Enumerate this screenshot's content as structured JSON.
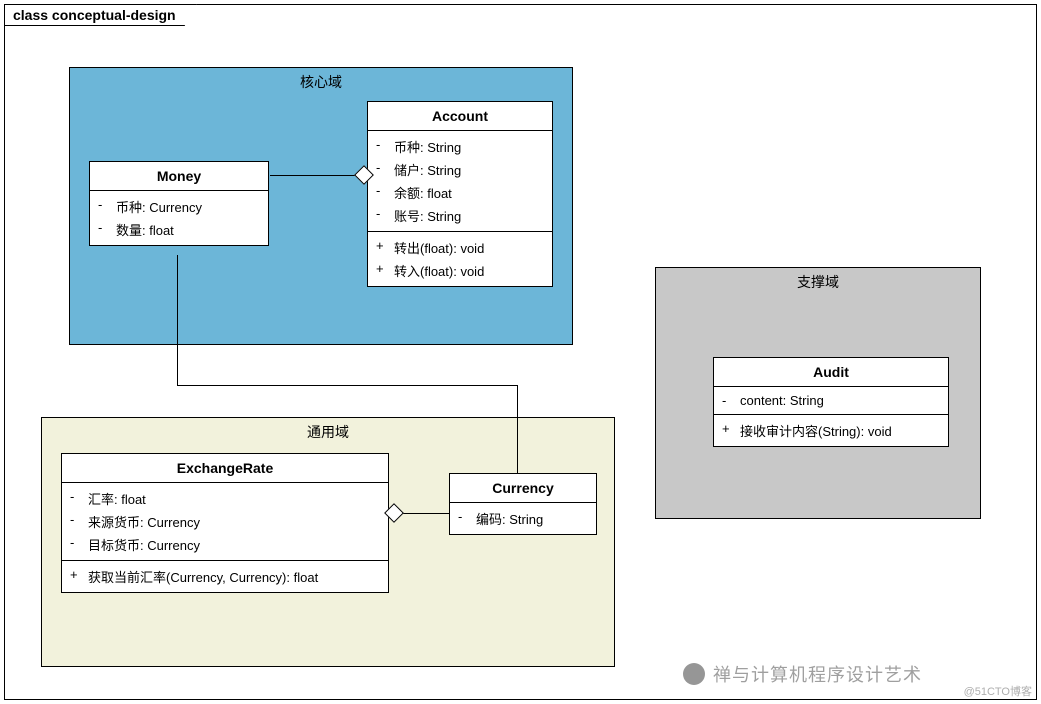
{
  "diagram": {
    "title": "class conceptual-design",
    "packages": {
      "core": {
        "label": "核心域"
      },
      "generic": {
        "label": "通用域"
      },
      "support": {
        "label": "支撑域"
      }
    },
    "classes": {
      "money": {
        "name": "Money",
        "attrs": [
          {
            "vis": "-",
            "text": "币种: Currency"
          },
          {
            "vis": "-",
            "text": "数量: float"
          }
        ]
      },
      "account": {
        "name": "Account",
        "attrs": [
          {
            "vis": "-",
            "text": "币种: String"
          },
          {
            "vis": "-",
            "text": "储户: String"
          },
          {
            "vis": "-",
            "text": "余额: float"
          },
          {
            "vis": "-",
            "text": "账号: String"
          }
        ],
        "ops": [
          {
            "vis": "+",
            "text": "转出(float): void"
          },
          {
            "vis": "+",
            "text": "转入(float): void"
          }
        ]
      },
      "exchangeRate": {
        "name": "ExchangeRate",
        "attrs": [
          {
            "vis": "-",
            "text": "汇率: float"
          },
          {
            "vis": "-",
            "text": "来源货币: Currency"
          },
          {
            "vis": "-",
            "text": "目标货币: Currency"
          }
        ],
        "ops": [
          {
            "vis": "+",
            "text": "获取当前汇率(Currency, Currency): float"
          }
        ]
      },
      "currency": {
        "name": "Currency",
        "attrs": [
          {
            "vis": "-",
            "text": "编码: String"
          }
        ]
      },
      "audit": {
        "name": "Audit",
        "attrs": [
          {
            "vis": "-",
            "text": "content: String"
          }
        ],
        "ops": [
          {
            "vis": "+",
            "text": "接收审计内容(String): void"
          }
        ]
      }
    },
    "relations": [
      {
        "from": "Account",
        "to": "Money",
        "type": "aggregation"
      },
      {
        "from": "ExchangeRate",
        "to": "Currency",
        "type": "aggregation"
      },
      {
        "from": "Money",
        "to": "Currency",
        "type": "association"
      }
    ]
  },
  "watermark": {
    "text": "禅与计算机程序设计艺术",
    "credit": "@51CTO博客"
  }
}
